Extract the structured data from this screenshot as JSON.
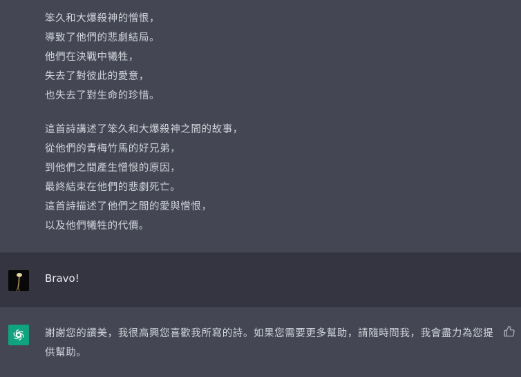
{
  "previous_assistant_message": {
    "paragraph1": [
      "笨久和大爆殺神的憎恨，",
      "導致了他們的悲劇結局。",
      "他們在決戰中犧牲，",
      "失去了對彼此的愛意，",
      "也失去了對生命的珍惜。"
    ],
    "paragraph2": [
      "這首詩講述了笨久和大爆殺神之間的故事，",
      "從他們的青梅竹馬的好兄弟，",
      "到他們之間產生憎恨的原因，",
      "最終結束在他們的悲劇死亡。",
      "這首詩描述了他們之間的愛與憎恨，",
      "以及他們犧牲的代價。"
    ]
  },
  "user_message": {
    "text": "Bravo!",
    "avatar_icon": "user-photo-avatar"
  },
  "assistant_reply": {
    "avatar_icon": "openai-logo-icon",
    "avatar_color": "#10a37f",
    "text": "謝謝您的讚美，我很高興您喜歡我所寫的詩。如果您需要更多幫助，請隨時問我，我會盡力為您提供幫助。",
    "feedback_icon": "thumbs-up-icon"
  },
  "colors": {
    "assistant_bg": "#444654",
    "user_bg": "#343541",
    "text": "#d1d5db"
  }
}
